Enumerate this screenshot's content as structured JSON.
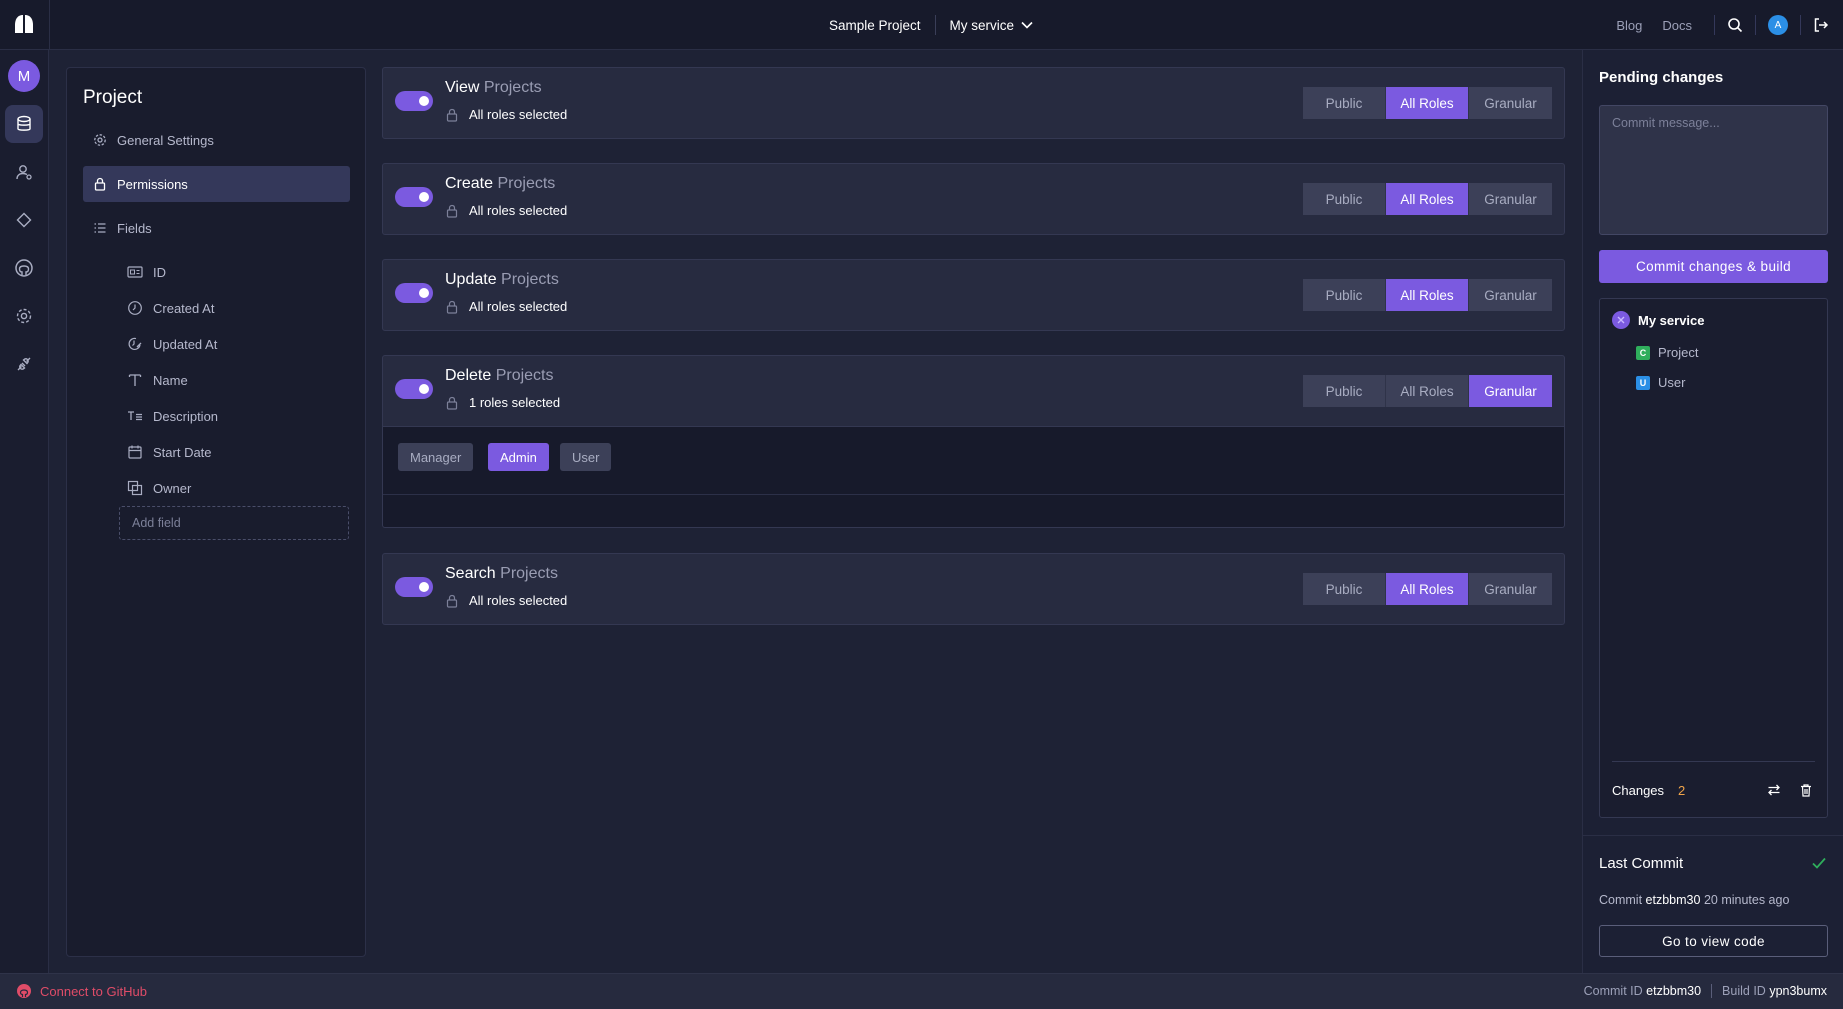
{
  "header": {
    "project_name": "Sample Project",
    "service_name": "My service",
    "links": [
      "Blog",
      "Docs"
    ],
    "user_initial": "A"
  },
  "rail": {
    "avatar_initial": "M",
    "icons": [
      "database-icon",
      "users-icon",
      "diamond-icon",
      "github-icon",
      "settings-icon",
      "plug-icon"
    ]
  },
  "sidebar": {
    "title": "Project",
    "items": [
      {
        "label": "General Settings",
        "icon": "gear-icon"
      },
      {
        "label": "Permissions",
        "icon": "lock-icon",
        "active": true
      },
      {
        "label": "Fields",
        "icon": "list-icon"
      }
    ],
    "fields": [
      {
        "label": "ID",
        "icon": "id-icon"
      },
      {
        "label": "Created At",
        "icon": "clock-icon"
      },
      {
        "label": "Updated At",
        "icon": "clock-edit-icon"
      },
      {
        "label": "Name",
        "icon": "text-icon"
      },
      {
        "label": "Description",
        "icon": "paragraph-icon"
      },
      {
        "label": "Start Date",
        "icon": "calendar-icon"
      },
      {
        "label": "Owner",
        "icon": "relation-icon"
      }
    ],
    "add_field_placeholder": "Add field"
  },
  "permissions": [
    {
      "action": "View",
      "entity": "Projects",
      "summary": "All roles selected",
      "options": [
        "Public",
        "All Roles",
        "Granular"
      ],
      "selected": "All Roles",
      "enabled": true
    },
    {
      "action": "Create",
      "entity": "Projects",
      "summary": "All roles selected",
      "options": [
        "Public",
        "All Roles",
        "Granular"
      ],
      "selected": "All Roles",
      "enabled": true
    },
    {
      "action": "Update",
      "entity": "Projects",
      "summary": "All roles selected",
      "options": [
        "Public",
        "All Roles",
        "Granular"
      ],
      "selected": "All Roles",
      "enabled": true
    },
    {
      "action": "Delete",
      "entity": "Projects",
      "summary": "1 roles selected",
      "options": [
        "Public",
        "All Roles",
        "Granular"
      ],
      "selected": "Granular",
      "enabled": true,
      "roles": [
        {
          "label": "Manager",
          "selected": false
        },
        {
          "label": "Admin",
          "selected": true
        },
        {
          "label": "User",
          "selected": false
        }
      ]
    },
    {
      "action": "Search",
      "entity": "Projects",
      "summary": "All roles selected",
      "options": [
        "Public",
        "All Roles",
        "Granular"
      ],
      "selected": "All Roles",
      "enabled": true
    }
  ],
  "pending": {
    "title": "Pending changes",
    "commit_placeholder": "Commit message...",
    "commit_button": "Commit changes & build",
    "service": "My service",
    "entities": [
      {
        "badge": "C",
        "label": "Project",
        "color": "#2fae5c"
      },
      {
        "badge": "U",
        "label": "User",
        "color": "#2b8fe6"
      }
    ],
    "changes_label": "Changes",
    "changes_count": "2"
  },
  "last_commit": {
    "title": "Last Commit",
    "prefix": "Commit",
    "commit_id": "etzbbm30",
    "time": "20 minutes ago",
    "button": "Go to view code"
  },
  "footer": {
    "github_link": "Connect to GitHub",
    "commit_id_label": "Commit ID",
    "commit_id": "etzbbm30",
    "build_id_label": "Build ID",
    "build_id": "ypn3bumx"
  },
  "colors": {
    "accent": "#7b5ae0",
    "background": "#1e2235",
    "panel": "#272b40",
    "danger": "#e04c68",
    "warning": "#f0a44a"
  }
}
